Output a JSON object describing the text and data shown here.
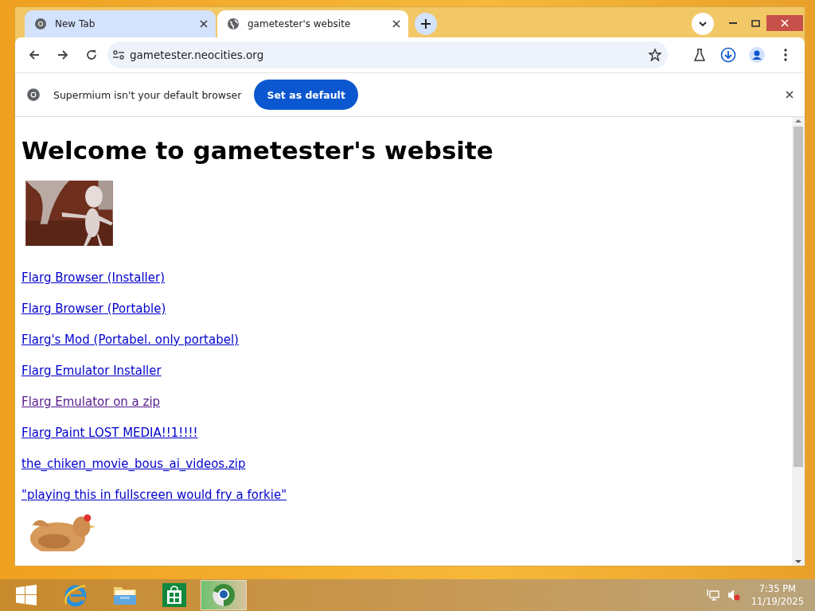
{
  "tabs": [
    {
      "title": "New Tab",
      "selected": false
    },
    {
      "title": "gametester's website",
      "selected": true
    }
  ],
  "address_bar": {
    "url": "gametester.neocities.org"
  },
  "infobar": {
    "message": "Supermium isn't your default browser",
    "button": "Set as default"
  },
  "page": {
    "heading": "Welcome to gametester's website",
    "links": [
      {
        "text": "Flarg Browser (Installer)",
        "visited": false
      },
      {
        "text": "Flarg Browser (Portable)",
        "visited": false
      },
      {
        "text": "Flarg's Mod (Portabel. only portabel)",
        "visited": false
      },
      {
        "text": "Flarg Emulator Installer",
        "visited": false
      },
      {
        "text": "Flarg Emulator on a zip",
        "visited": true
      },
      {
        "text": "Flarg Paint LOST MEDIA!!1!!!!",
        "visited": false
      },
      {
        "text": "the_chiken_movie_bous_ai_videos.zip",
        "visited": false
      },
      {
        "text": "\"playing this in fullscreen would fry a forkie\"",
        "visited": false
      }
    ]
  },
  "taskbar": {
    "apps": [
      {
        "kind": "start",
        "selected": false
      },
      {
        "kind": "ie",
        "selected": false
      },
      {
        "kind": "explorer",
        "selected": false
      },
      {
        "kind": "store",
        "selected": false
      },
      {
        "kind": "browser",
        "selected": true
      }
    ],
    "time": "7:35 PM",
    "date": "11/19/2025"
  }
}
